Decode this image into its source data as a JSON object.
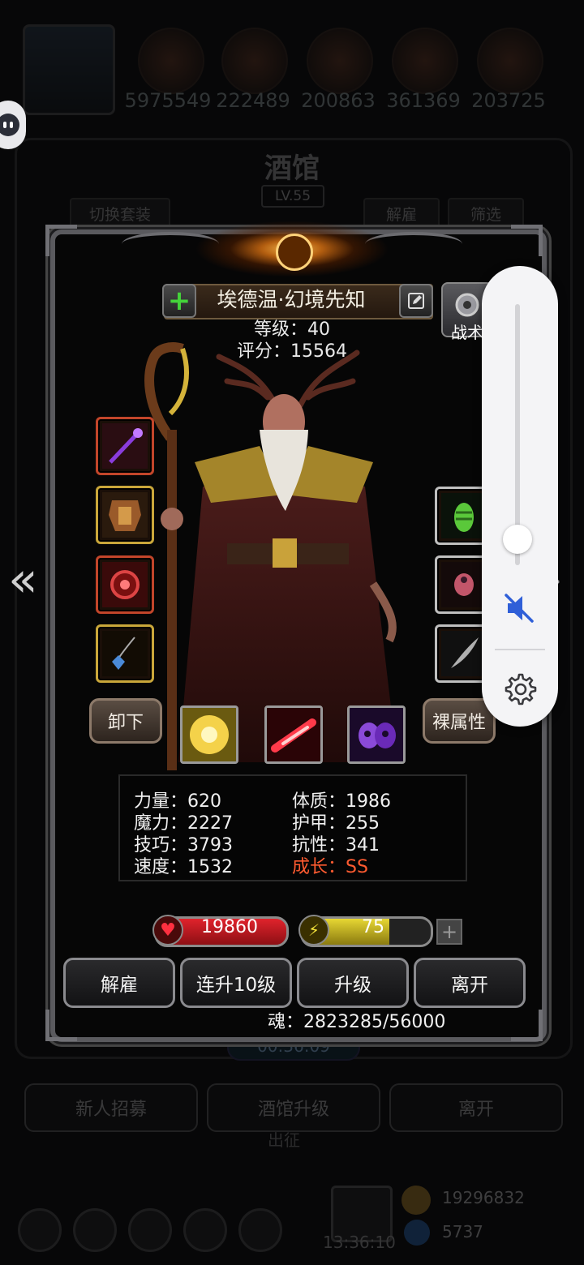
{
  "background": {
    "resources": [
      "5975549",
      "222489",
      "200863",
      "361369",
      "203725"
    ],
    "screen_title": "酒馆",
    "screen_level": "LV.55",
    "tabs": {
      "switch_outfit": "切换套装",
      "dismiss": "解雇",
      "filter": "筛选"
    },
    "timer": "00:36:09",
    "buttons": [
      "新人招募",
      "酒馆升级",
      "离开"
    ],
    "sub_label": "出征",
    "clock": "13:36:10",
    "coins": "19296832",
    "gems": "5737"
  },
  "hero": {
    "name": "埃德温·幻境先知",
    "level_text": "等级：40",
    "score_text": "评分：15564",
    "tactics_label": "战术"
  },
  "equipment": {
    "left_slots": [
      "staff",
      "armor",
      "ring",
      "amulet"
    ],
    "right_slots": [
      "gem",
      "orb",
      "feather"
    ]
  },
  "buttons": {
    "unequip": "卸下",
    "bare_stats": "裸属性"
  },
  "skills": [
    "light-burst",
    "red-strike",
    "shadow-skull"
  ],
  "stats": {
    "strength": "力量：620",
    "constitution": "体质：1986",
    "magic": "魔力：2227",
    "armor": "护甲：255",
    "skill": "技巧：3793",
    "resistance": "抗性：341",
    "speed": "速度：1532",
    "growth": "成长：SS"
  },
  "bars": {
    "hp": "19860",
    "energy": "75",
    "energy_fraction": 0.68
  },
  "actions": {
    "dismiss": "解雇",
    "level_up_10": "连升10级",
    "level_up": "升级",
    "leave": "离开"
  },
  "soul": "魂：2823285/56000",
  "colors": {
    "growth": "#ff5b30",
    "hp": "#e0232c",
    "energy": "#e7d733",
    "mute_icon": "#2f5fd8"
  },
  "volume": {
    "level": 0.1,
    "muted": true
  }
}
